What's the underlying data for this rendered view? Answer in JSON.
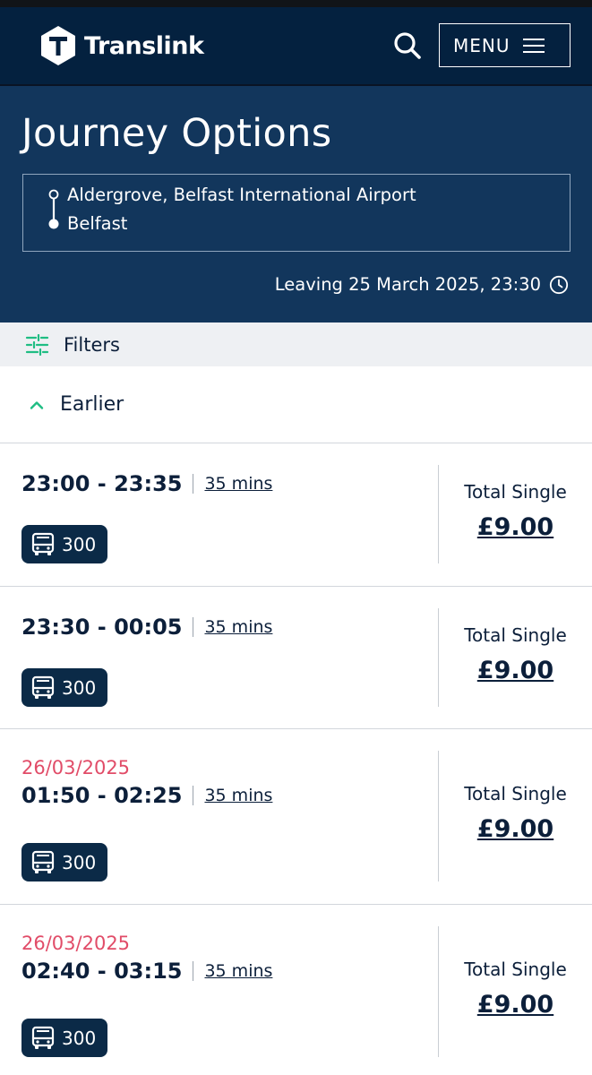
{
  "header": {
    "brand": "Translink",
    "menu_label": "MENU"
  },
  "hero": {
    "title": "Journey Options",
    "from": "Aldergrove, Belfast International Airport",
    "to": "Belfast",
    "leaving": "Leaving 25 March 2025, 23:30"
  },
  "filters": {
    "label": "Filters"
  },
  "earlier": {
    "label": "Earlier"
  },
  "journeys": [
    {
      "date": "",
      "times": "23:00 - 23:35",
      "duration": "35 mins",
      "route": "300",
      "fare_label": "Total Single",
      "fare": "£9.00"
    },
    {
      "date": "",
      "times": "23:30 - 00:05",
      "duration": "35 mins",
      "route": "300",
      "fare_label": "Total Single",
      "fare": "£9.00"
    },
    {
      "date": "26/03/2025",
      "times": "01:50 - 02:25",
      "duration": "35 mins",
      "route": "300",
      "fare_label": "Total Single",
      "fare": "£9.00"
    },
    {
      "date": "26/03/2025",
      "times": "02:40 - 03:15",
      "duration": "35 mins",
      "route": "300",
      "fare_label": "Total Single",
      "fare": "£9.00"
    }
  ],
  "colors": {
    "header_bg": "#04213f",
    "hero_bg": "#12365c",
    "accent_green": "#1fbd83",
    "date_red": "#e14c68",
    "badge_bg": "#0b2a47"
  },
  "icons": {
    "logo": "translink-logo-icon",
    "search": "search-icon",
    "menu": "hamburger-icon",
    "clock": "clock-icon",
    "filters": "sliders-icon",
    "earlier": "chevron-up-icon",
    "bus": "bus-icon"
  }
}
